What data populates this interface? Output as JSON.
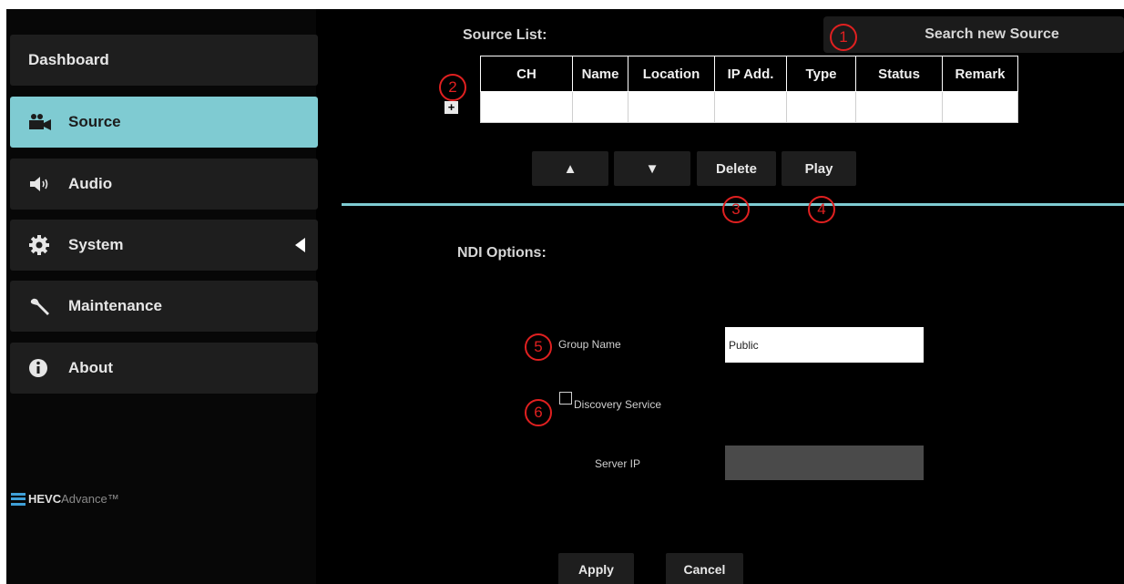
{
  "sidebar": {
    "items": [
      {
        "label": "Dashboard",
        "icon": "none"
      },
      {
        "label": "Source",
        "icon": "camera-icon",
        "active": true
      },
      {
        "label": "Audio",
        "icon": "speaker-icon"
      },
      {
        "label": "System",
        "icon": "gear-icon"
      },
      {
        "label": "Maintenance",
        "icon": "wrench-icon"
      },
      {
        "label": "About",
        "icon": "info-icon"
      }
    ],
    "logo": {
      "bold": "HEVC",
      "light": "Advance",
      "tm": "™"
    }
  },
  "source_list": {
    "title": "Source List:",
    "search_button": "Search new Source",
    "add_button": "+",
    "columns": [
      "CH",
      "Name",
      "Location",
      "IP Add.",
      "Type",
      "Status",
      "Remark"
    ],
    "rows": [
      [
        "",
        "",
        "",
        "",
        "",
        "",
        ""
      ]
    ],
    "buttons": {
      "up": "▲",
      "down": "▼",
      "delete": "Delete",
      "play": "Play"
    }
  },
  "ndi": {
    "title": "NDI Options:",
    "group_name_label": "Group Name",
    "group_name_value": "Public",
    "discovery_label": "Discovery Service",
    "discovery_checked": false,
    "server_ip_label": "Server IP",
    "server_ip_value": ""
  },
  "footer": {
    "apply": "Apply",
    "cancel": "Cancel"
  },
  "callouts": [
    "1",
    "2",
    "3",
    "4",
    "5",
    "6"
  ],
  "colors": {
    "accent": "#7fcbd2",
    "callout": "#e02020",
    "background": "#000000"
  }
}
